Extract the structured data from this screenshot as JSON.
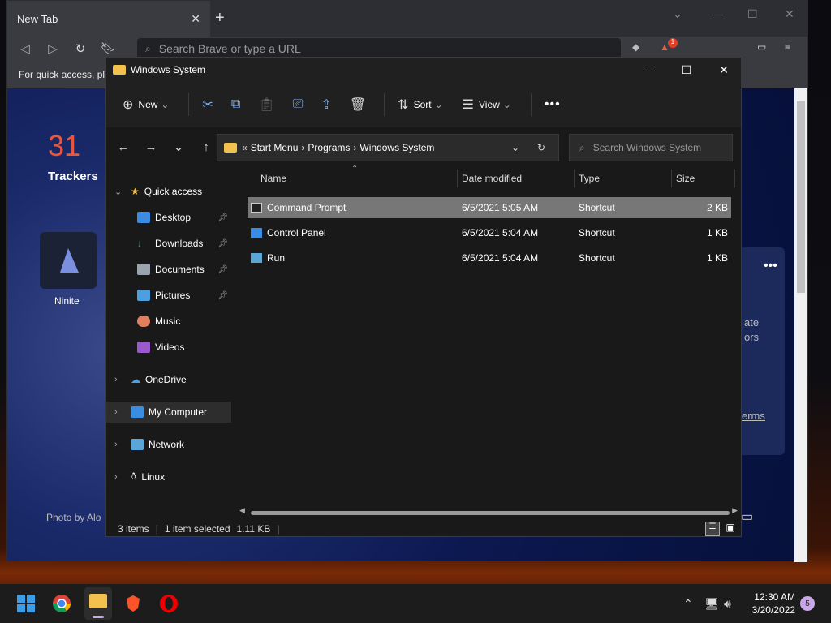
{
  "browser": {
    "tab_title": "New Tab",
    "url_placeholder": "Search Brave or type a URL",
    "bookmark_hint": "For quick access, pla",
    "rewards_badge": "1",
    "ntp": {
      "trackers_count": "31",
      "trackers_label": "Trackers",
      "tile_label": "Ninite",
      "card_text_1": "ate",
      "card_text_2": "ors",
      "card_link": "erms",
      "photo_credit": "Photo by Alo"
    }
  },
  "explorer": {
    "title": "Windows System",
    "commands": {
      "new": "New",
      "sort": "Sort",
      "view": "View"
    },
    "breadcrumb": [
      "Start Menu",
      "Programs",
      "Windows System"
    ],
    "breadcrumb_prefix": "«",
    "search_placeholder": "Search Windows System",
    "nav": {
      "quick_access": "Quick access",
      "desktop": "Desktop",
      "downloads": "Downloads",
      "documents": "Documents",
      "pictures": "Pictures",
      "music": "Music",
      "videos": "Videos",
      "onedrive": "OneDrive",
      "my_computer": "My Computer",
      "network": "Network",
      "linux": "Linux"
    },
    "columns": {
      "name": "Name",
      "date": "Date modified",
      "type": "Type",
      "size": "Size"
    },
    "files": [
      {
        "name": "Command Prompt",
        "date": "6/5/2021 5:05 AM",
        "type": "Shortcut",
        "size": "2 KB"
      },
      {
        "name": "Control Panel",
        "date": "6/5/2021 5:04 AM",
        "type": "Shortcut",
        "size": "1 KB"
      },
      {
        "name": "Run",
        "date": "6/5/2021 5:04 AM",
        "type": "Shortcut",
        "size": "1 KB"
      }
    ],
    "status": {
      "items": "3 items",
      "selected": "1 item selected",
      "size": "1.11 KB"
    }
  },
  "taskbar": {
    "time": "12:30 AM",
    "date": "3/20/2022",
    "notifications": "5"
  },
  "colors": {
    "accent": "#7fb5ff",
    "folder": "#f2c14e",
    "tracker_count": "#e9573f"
  }
}
